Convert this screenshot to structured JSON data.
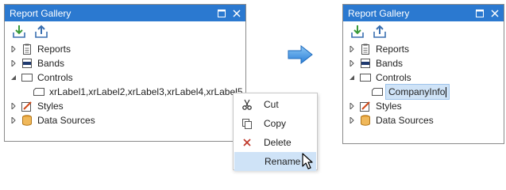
{
  "left_panel": {
    "title": "Report Gallery",
    "tree": [
      {
        "label": "Reports"
      },
      {
        "label": "Bands"
      },
      {
        "label": "Controls"
      },
      {
        "label": "xrLabel1,xrLabel2,xrLabel3,xrLabel4,xrLabel5"
      },
      {
        "label": "Styles"
      },
      {
        "label": "Data Sources"
      }
    ]
  },
  "context_menu": {
    "items": [
      {
        "label": "Cut",
        "icon": "scissors-icon"
      },
      {
        "label": "Copy",
        "icon": "copy-icon"
      },
      {
        "label": "Delete",
        "icon": "delete-x-icon"
      },
      {
        "label": "Rename",
        "icon": "",
        "highlighted": true
      }
    ]
  },
  "right_panel": {
    "title": "Report Gallery",
    "tree": [
      {
        "label": "Reports"
      },
      {
        "label": "Bands"
      },
      {
        "label": "Controls"
      },
      {
        "label": "CompanyInfo"
      },
      {
        "label": "Styles"
      },
      {
        "label": "Data Sources"
      }
    ]
  },
  "colors": {
    "title_bar": "#2b79d0",
    "selection": "#cfe3f7",
    "arrow": "#3b8fe0"
  }
}
